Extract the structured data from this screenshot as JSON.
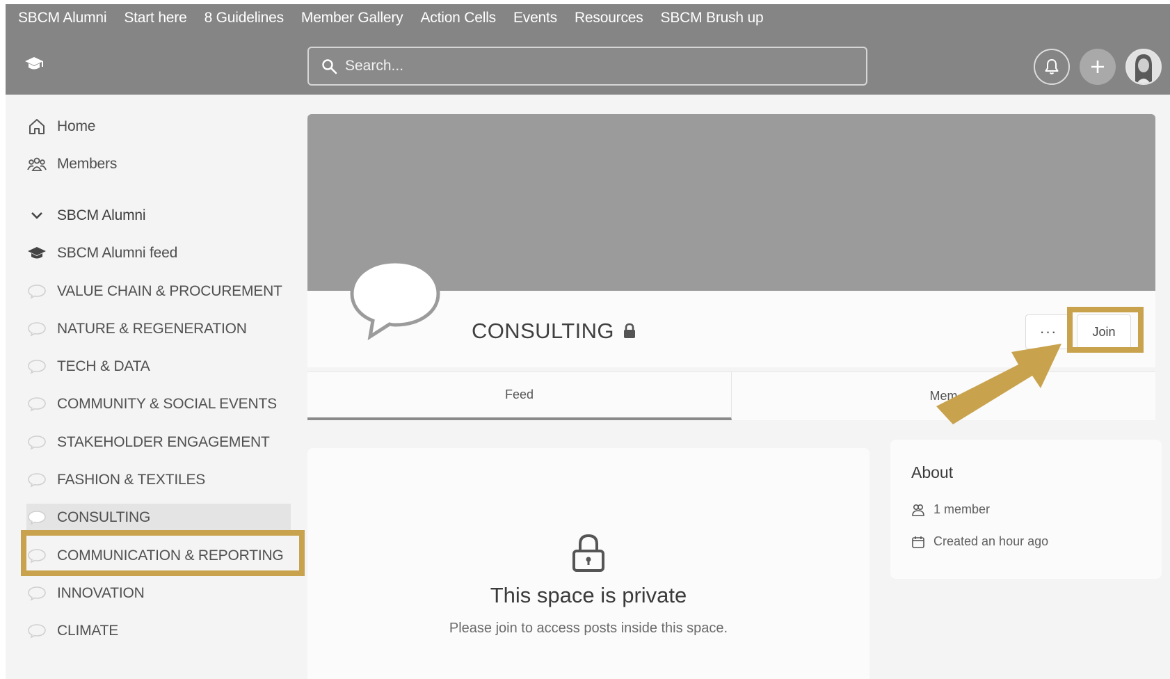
{
  "nav": {
    "menu": [
      "SBCM Alumni",
      "Start here",
      "8 Guidelines",
      "Member Gallery",
      "Action Cells",
      "Events",
      "Resources",
      "SBCM Brush up"
    ],
    "search_placeholder": "Search..."
  },
  "sidebar": {
    "home": "Home",
    "members": "Members",
    "section": "SBCM Alumni",
    "feed": "SBCM Alumni feed",
    "spaces": [
      "VALUE CHAIN & PROCUREMENT",
      "NATURE & REGENERATION",
      "TECH & DATA",
      "COMMUNITY & SOCIAL EVENTS",
      "STAKEHOLDER ENGAGEMENT",
      "FASHION & TEXTILES",
      "CONSULTING",
      "COMMUNICATION & REPORTING",
      "INNOVATION",
      "CLIMATE"
    ],
    "active_space": "CONSULTING"
  },
  "space": {
    "title": "CONSULTING",
    "more_label": "···",
    "join_label": "Join",
    "tabs": [
      "Feed",
      "Mem"
    ]
  },
  "private": {
    "title": "This space is private",
    "subtitle": "Please join to access posts inside this space."
  },
  "about": {
    "title": "About",
    "members": "1 member",
    "created": "Created an hour ago"
  },
  "colors": {
    "highlight": "#c9a24d",
    "topbar": "#858585",
    "cover": "#9b9b9b"
  }
}
